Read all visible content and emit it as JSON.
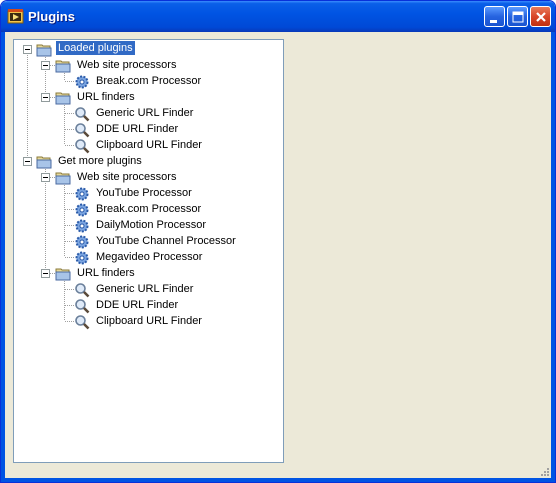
{
  "window": {
    "title": "Plugins"
  },
  "tree": {
    "loaded": {
      "label": "Loaded plugins",
      "web": {
        "label": "Web site processors",
        "items": [
          "Break.com Processor"
        ]
      },
      "url": {
        "label": "URL finders",
        "items": [
          "Generic URL Finder",
          "DDE URL Finder",
          "Clipboard URL Finder"
        ]
      }
    },
    "more": {
      "label": "Get more plugins",
      "web": {
        "label": "Web site processors",
        "items": [
          "YouTube Processor",
          "Break.com Processor",
          "DailyMotion Processor",
          "YouTube Channel Processor",
          "Megavideo Processor"
        ]
      },
      "url": {
        "label": "URL finders",
        "items": [
          "Generic URL Finder",
          "DDE URL Finder",
          "Clipboard URL Finder"
        ]
      }
    }
  }
}
